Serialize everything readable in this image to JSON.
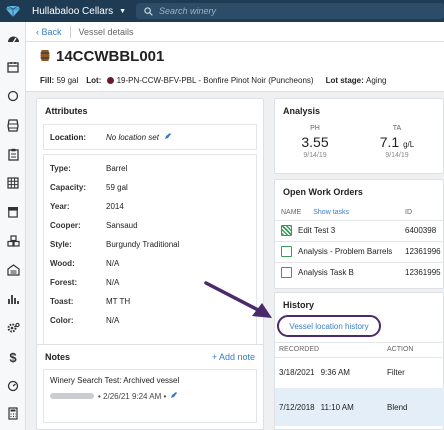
{
  "app": {
    "title": "Hullabaloo Cellars"
  },
  "search": {
    "placeholder": "Search winery"
  },
  "subheader": {
    "back": "Back",
    "crumb": "Vessel details"
  },
  "vessel": {
    "name": "14CCWBBL001",
    "fill_label": "Fill:",
    "fill_value": "59 gal",
    "lot_label": "Lot:",
    "lot_value": "19-PN-CCW-BFV-PBL - Bonfire Pinot Noir (Puncheons)",
    "stage_label": "Lot stage:",
    "stage_value": "Aging"
  },
  "attributes": {
    "heading": "Attributes",
    "location_label": "Location:",
    "location_value": "No location set",
    "rows": [
      {
        "k": "Type:",
        "v": "Barrel"
      },
      {
        "k": "Capacity:",
        "v": "59 gal"
      },
      {
        "k": "Year:",
        "v": "2014"
      },
      {
        "k": "Cooper:",
        "v": "Sansaud"
      },
      {
        "k": "Style:",
        "v": "Burgundy Traditional"
      },
      {
        "k": "Wood:",
        "v": "N/A"
      },
      {
        "k": "Forest:",
        "v": "N/A"
      },
      {
        "k": "Toast:",
        "v": "MT TH"
      },
      {
        "k": "Color:",
        "v": "N/A"
      }
    ]
  },
  "notes": {
    "heading": "Notes",
    "add": "+ Add note",
    "text": "Winery Search Test: Archived vessel",
    "date": "• 2/26/21 9:24 AM •"
  },
  "analysis": {
    "heading": "Analysis",
    "ph_label": "PH",
    "ph_value": "3.55",
    "ph_date": "9/14/19",
    "ta_label": "TA",
    "ta_value": "7.1",
    "ta_unit": "g/L",
    "ta_date": "9/14/19"
  },
  "work_orders": {
    "heading": "Open Work Orders",
    "col_name": "NAME",
    "show_tasks": "Show tasks",
    "col_id": "ID",
    "rows": [
      {
        "name": "Edit Test 3",
        "id": "6400398"
      },
      {
        "name": "Analysis - Problem Barrels",
        "id": "12361996"
      },
      {
        "name": "Analysis Task B",
        "id": "12361995"
      }
    ]
  },
  "history": {
    "heading": "History",
    "link": "Vessel location history",
    "col_recorded": "RECORDED",
    "col_action": "ACTION",
    "rows": [
      {
        "date": "3/18/2021",
        "time": "9:36 AM",
        "action": "Filter"
      },
      {
        "date": "7/12/2018",
        "time": "11:10 AM",
        "action": "Blend"
      }
    ]
  },
  "colors": {
    "nav": "#1f3b54",
    "link": "#3a7dc2",
    "annotation": "#4a2a6a"
  }
}
